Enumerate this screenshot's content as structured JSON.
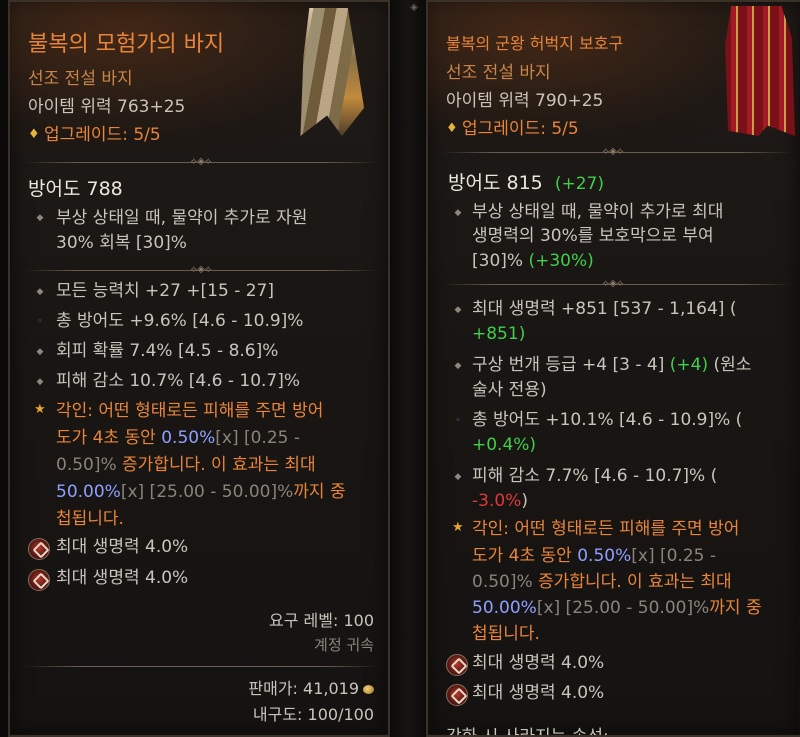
{
  "left": {
    "name": "불복의 모험가의 바지",
    "type": "선조 전설 바지",
    "item_power": "아이템 위력 763+25",
    "upgrade_icon": "♦",
    "upgrade": "업그레이드: 5/5",
    "defense": "방어도 788",
    "implicit": [
      "부상 상태일 때, 물약이 추가로 자원",
      "30% 회복 [30]%"
    ],
    "stats": [
      "모든 능력치 +27 +[15 - 27]",
      "총 방어도 +9.6% [4.6 - 10.9]%",
      "회피 확률 7.4% [4.5 - 8.6]%",
      "피해 감소 10.7% [4.6 - 10.7]%"
    ],
    "aspect": {
      "l1_label": "각인: ",
      "l1_text": "어떤 형태로든 피해를 주면 방어",
      "l2_a": "도가 4초 동안 ",
      "l2_val": "0.50%",
      "l2_x": "[x]",
      "l2_range": " [0.25 -",
      "l3_range": "0.50]% ",
      "l3_text": "증가합니다. 이 효과는 최대",
      "l4_val": "50.00%",
      "l4_x": "[x]",
      "l4_range": " [25.00 - 50.00]%",
      "l4_text": "까지 중",
      "l5_text": "첩됩니다."
    },
    "gems": [
      "최대 생명력 4.0%",
      "최대 생명력 4.0%"
    ],
    "req_level": "요구 레벨: 100",
    "bound": "계정 귀속",
    "sell_label": "판매가: 41,019",
    "durability": "내구도: 100/100"
  },
  "right": {
    "name": "불복의 군왕 허벅지 보호구",
    "type": "선조 전설 바지",
    "item_power": "아이템 위력 790+25",
    "upgrade_icon": "♦",
    "upgrade": "업그레이드: 5/5",
    "defense": "방어도 815",
    "defense_diff": "(+27)",
    "implicit": [
      "부상 상태일 때, 물약이 추가로 최대",
      "생명력의 30%를 보호막으로 부여"
    ],
    "implicit_l3_a": "[30]% ",
    "implicit_l3_b": "(+30%)",
    "stat1_l1": "최대 생명력 +851 [537 - 1,164] (",
    "stat1_l2": "+851)",
    "stat2_l1_a": "구상 번개 등급 +4 [3 - 4] ",
    "stat2_l1_b": "(+4)",
    "stat2_l1_c": " (원소",
    "stat2_l2": "술사 전용)",
    "stat3_l1": "총 방어도 +10.1% [4.6 - 10.9]% (",
    "stat3_l2": "+0.4%)",
    "stat4_l1": "피해 감소 7.7% [4.6 - 10.7]% (",
    "stat4_l2_a": "-3.0%",
    "stat4_l2_b": ")",
    "aspect": {
      "l1_label": "각인: ",
      "l1_text": "어떤 형태로든 피해를 주면 방어",
      "l2_a": "도가 4초 동안 ",
      "l2_val": "0.50%",
      "l2_x": "[x]",
      "l2_range": " [0.25 -",
      "l3_range": "0.50]% ",
      "l3_text": "증가합니다. 이 효과는 최대",
      "l4_val": "50.00%",
      "l4_x": "[x]",
      "l4_range": " [25.00 - 50.00]%",
      "l4_text": "까지 중",
      "l5_text": "첩됩니다."
    },
    "gems": [
      "최대 생명력 4.0%",
      "최대 생명력 4.0%"
    ],
    "cut_off": "강화 시 사라지는 속성:"
  },
  "colors": {
    "item_name": "#e8853a",
    "positive_diff": "#3fcf4a",
    "negative_diff": "#e03838",
    "aspect_value": "#8fa0ff"
  }
}
